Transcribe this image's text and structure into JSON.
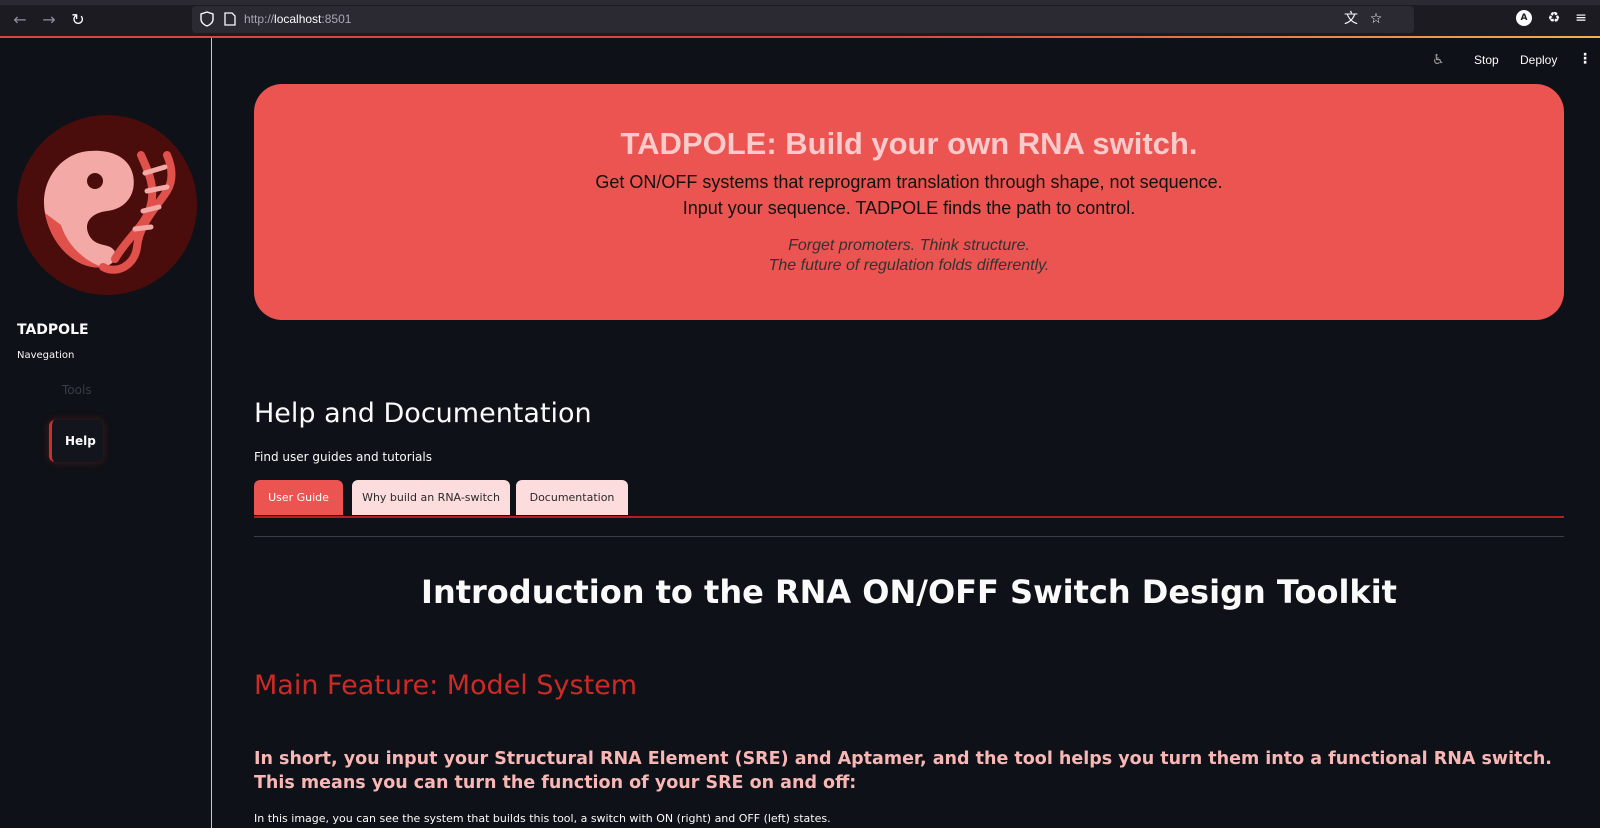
{
  "browser": {
    "url_prefix": "http://",
    "url_host": "localhost",
    "url_port": ":8501"
  },
  "header": {
    "stop_label": "Stop",
    "deploy_label": "Deploy"
  },
  "sidebar": {
    "app_name": "TADPOLE",
    "nav_label": "Navegation",
    "items": [
      {
        "label": "Tools"
      },
      {
        "label": "Help"
      }
    ]
  },
  "hero": {
    "title": "TADPOLE: Build your own RNA switch.",
    "line1": "Get ON/OFF systems that reprogram translation through shape, not sequence.",
    "line2": "Input your sequence. TADPOLE finds the path to control.",
    "quote1": "Forget promoters. Think structure.",
    "quote2": "The future of regulation folds differently."
  },
  "main": {
    "title": "Help and Documentation",
    "subtitle": "Find user guides and tutorials",
    "tabs": [
      {
        "label": "User Guide",
        "active": true
      },
      {
        "label": "Why build an RNA-switch",
        "active": false
      },
      {
        "label": "Documentation",
        "active": false
      }
    ],
    "intro_heading": "Introduction to the RNA ON/OFF Switch Design Toolkit",
    "feature_heading": "Main Feature: Model System",
    "short_desc": "In short, you input your Structural RNA Element (SRE) and Aptamer, and the tool helps you turn them into a functional RNA switch. This means you can turn the function of your SRE on and off:",
    "image_caption": "In this image, you can see the system that builds this tool, a switch with ON (right) and OFF (left) states."
  },
  "colors": {
    "accent": "#eb5450",
    "accent_dark": "#cc2a25",
    "background": "#0e1117",
    "tab_inactive": "#fcdcdc"
  }
}
